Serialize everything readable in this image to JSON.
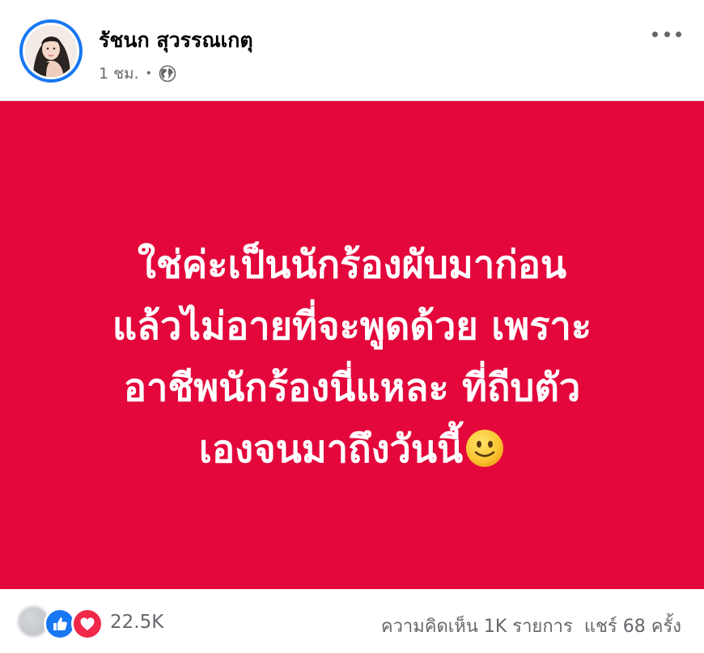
{
  "post": {
    "author": "รัชนก สุวรรณเกตุ",
    "time": "1 ชม.",
    "separator": "•",
    "privacy_icon": "globe-icon",
    "more_icon": "more-options-icon",
    "colors": {
      "card_background": "#e3073c",
      "card_text": "#ffffff",
      "avatar_ring": "#1877f2",
      "like": "#1877f2",
      "love": "#f0284a",
      "meta_text": "#65676b"
    }
  },
  "card": {
    "lines": [
      "ใช่ค่ะเป็นนักร้องผับมาก่อน",
      "แล้วไม่อายที่จะพูดด้วย เพราะ",
      "อาชีพนักร้องนี่แหละ ที่ถีบตัว",
      "เองจนมาถึงวันนี้"
    ],
    "emoji": "slightly-smiling-face-icon"
  },
  "reactions": {
    "count": "22.5K",
    "icons": [
      "blurred-reaction-icon",
      "like-icon",
      "love-icon"
    ]
  },
  "stats": {
    "comments": "ความคิดเห็น 1K รายการ",
    "shares": "แชร์ 68 ครั้ง"
  }
}
